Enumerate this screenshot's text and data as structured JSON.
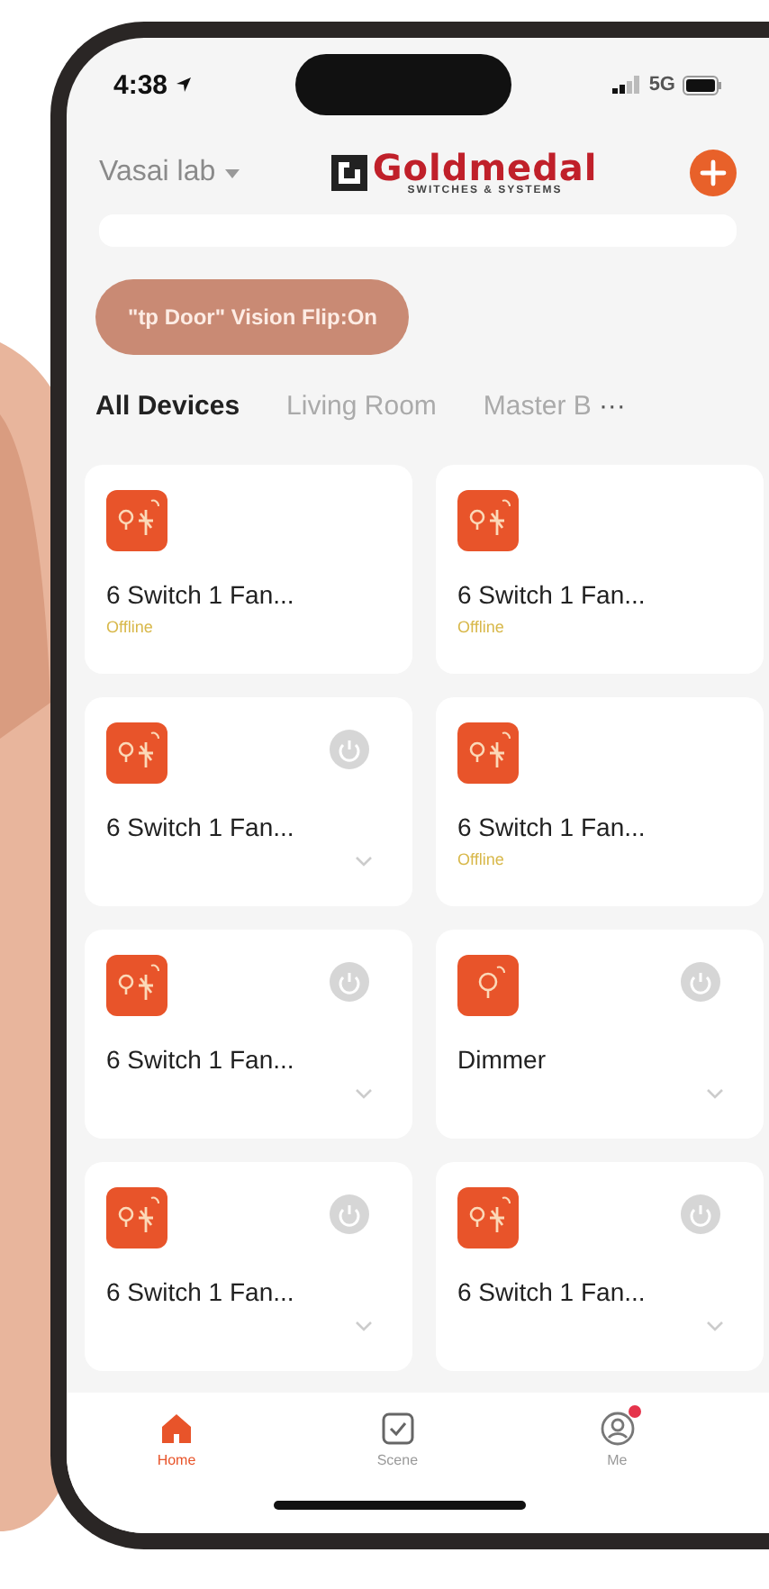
{
  "status_bar": {
    "time": "4:38",
    "network": "5G"
  },
  "header": {
    "home_name": "Vasai lab",
    "logo": {
      "name": "Goldmedal",
      "tagline": "SWITCHES & SYSTEMS"
    }
  },
  "scene_chip": {
    "label": "\"tp Door\" Vision Flip:On"
  },
  "tabs": [
    {
      "label": "All Devices",
      "selected": true
    },
    {
      "label": "Living Room",
      "selected": false
    },
    {
      "label": "Master B",
      "selected": false
    }
  ],
  "tabs_more": "···",
  "devices": [
    {
      "kind": "switch_fan",
      "name": "6 Switch 1 Fan...",
      "online": false,
      "status": "Offline"
    },
    {
      "kind": "switch_fan",
      "name": "6 Switch 1 Fan...",
      "online": false,
      "status": "Offline"
    },
    {
      "kind": "switch_fan",
      "name": "6 Switch 1 Fan...",
      "online": true
    },
    {
      "kind": "switch_fan",
      "name": "6 Switch 1 Fan...",
      "online": false,
      "status": "Offline"
    },
    {
      "kind": "switch_fan",
      "name": "6 Switch 1 Fan...",
      "online": true
    },
    {
      "kind": "dimmer",
      "name": "Dimmer",
      "online": true
    },
    {
      "kind": "switch_fan",
      "name": "6 Switch 1 Fan...",
      "online": true
    },
    {
      "kind": "switch_fan",
      "name": "6 Switch 1 Fan...",
      "online": true
    }
  ],
  "bottom_nav": [
    {
      "kind": "home",
      "label": "Home",
      "selected": true,
      "badge": false
    },
    {
      "kind": "scene",
      "label": "Scene",
      "selected": false,
      "badge": false
    },
    {
      "kind": "me",
      "label": "Me",
      "selected": false,
      "badge": true
    }
  ]
}
